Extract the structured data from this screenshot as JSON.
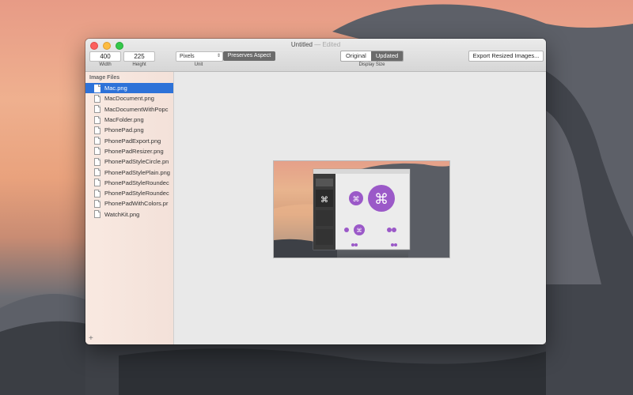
{
  "window": {
    "title": "Untitled",
    "separator": "—",
    "status": "Edited"
  },
  "toolbar": {
    "width_value": "400",
    "width_label": "Width",
    "height_value": "225",
    "height_label": "Height",
    "unit_value": "Pixels",
    "unit_label": "Unit",
    "aspect_button": "Preserves Aspect",
    "display_original": "Original",
    "display_updated": "Updated",
    "display_label": "Display Size",
    "export_button": "Export Resized Images..."
  },
  "sidebar": {
    "header": "Image Files",
    "files": [
      "Mac.png",
      "MacDocument.png",
      "MacDocumentWithPopc",
      "MacFolder.png",
      "PhonePad.png",
      "PhonePadExport.png",
      "PhonePadResizer.png",
      "PhonePadStyleCircle.pn",
      "PhonePadStylePlain.png",
      "PhonePadStyleRoundec",
      "PhonePadStyleRoundec",
      "PhonePadWithColors.pr",
      "WatchKit.png"
    ],
    "selected_index": 0,
    "add_label": "+"
  },
  "colors": {
    "selection": "#2e72d8",
    "button_dark": "#6b6b6b"
  },
  "icons": {
    "add": "plus-icon",
    "file": "file-icon",
    "unit_chevron": "chevron-updown-icon"
  }
}
